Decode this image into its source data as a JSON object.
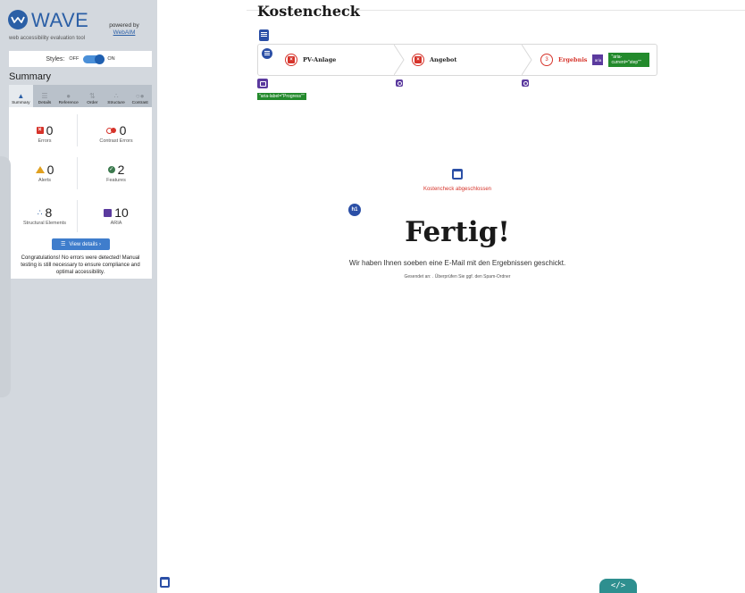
{
  "wave": {
    "brand": "WAVE",
    "tagline": "web accessibility evaluation tool",
    "powered_by": "powered by",
    "powered_link": "WebAIM",
    "styles": {
      "label": "Styles:",
      "off": "OFF",
      "on": "ON",
      "state": "on"
    },
    "summary_heading": "Summary",
    "tabs": [
      {
        "label": "Summary",
        "icon": "home-icon",
        "active": true
      },
      {
        "label": "Details",
        "icon": "list-icon"
      },
      {
        "label": "Reference",
        "icon": "info-icon"
      },
      {
        "label": "Order",
        "icon": "order-icon"
      },
      {
        "label": "Structure",
        "icon": "structure-icon"
      },
      {
        "label": "Contrast",
        "icon": "contrast-icon"
      }
    ],
    "stats": {
      "errors": {
        "value": "0",
        "label": "Errors"
      },
      "contrast_errors": {
        "value": "0",
        "label": "Contrast Errors"
      },
      "alerts": {
        "value": "0",
        "label": "Alerts"
      },
      "features": {
        "value": "2",
        "label": "Features"
      },
      "structural": {
        "value": "8",
        "label": "Structural Elements"
      },
      "aria": {
        "value": "10",
        "label": "ARIA"
      }
    },
    "view_details": "View details ›",
    "congrats": "Congratulations! No errors were detected! Manual testing is still necessary to ensure compliance and optimal accessibility.",
    "colors": {
      "accent": "#2b5fa6",
      "error": "#d6332a",
      "alert": "#e0a020",
      "feature": "#3c7a4e",
      "aria": "#5b3a9e",
      "sidebar_bg": "#d3d8de"
    }
  },
  "page": {
    "heading": "Kostencheck",
    "steps": [
      {
        "label": "PV-Anlage",
        "state": "error-icon"
      },
      {
        "label": "Angebot",
        "state": "error-icon"
      },
      {
        "label": "Ergebnis",
        "number": "3",
        "state": "current"
      }
    ],
    "aria_chip": "aria",
    "aria_current_tag": "\"aria-current=\"step\"\"",
    "aria_label_tag": "\"aria-label=\"Progress\"\"",
    "done_caption": "Kostencheck abgeschlossen",
    "h1_badge": "h1",
    "done_title": "Fertig!",
    "mail_text": "Wir haben Ihnen soeben eine E-Mail mit den Ergebnissen geschickt.",
    "sent_text": "Gesendet an: . Überprüfen Sie ggf. den Spam-Ordner",
    "code_button": "</>"
  }
}
